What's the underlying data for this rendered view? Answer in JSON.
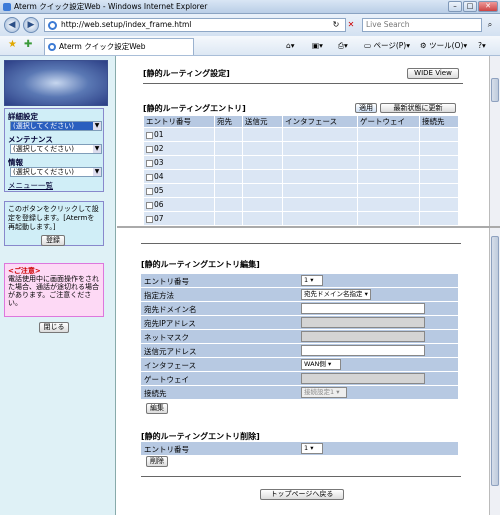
{
  "window": {
    "title": "Aterm クイック設定Web - Windows Internet Explorer"
  },
  "address": {
    "url": "http://web.setup/index_frame.html",
    "search_placeholder": "Live Search"
  },
  "tab": {
    "label": "Aterm クイック設定Web"
  },
  "toolbar": {
    "page": "ページ(P)",
    "tools": "ツール(O)",
    "help": "?"
  },
  "left": {
    "menu": {
      "detail_label": "詳細設定",
      "detail_value": "(選択してください)",
      "maint_label": "メンテナンス",
      "maint_value": "(選択してください)",
      "info_label": "情報",
      "info_value": "(選択してください)",
      "list_link": "メニュー一覧"
    },
    "register_text": "このボタンをクリックして設定を登録します。[Atermを再起動します。]",
    "register_button": "登録",
    "caution_title": "<ご注意>",
    "caution_text": "電話使用中に画面操作をされた場合、通話が途切れる場合があります。ご注意ください。",
    "close_button": "閉じる"
  },
  "main": {
    "page_title": "[静的ルーティング設定]",
    "wide_button": "WIDE View",
    "entry_title": "[静的ルーティングエントリ]",
    "apply_button": "適用",
    "refresh_button": "最新状態に更新",
    "entry_headers": [
      "エントリ番号",
      "宛先",
      "送信元",
      "インタフェース",
      "ゲートウェイ",
      "接続先"
    ],
    "entries": [
      "01",
      "02",
      "03",
      "04",
      "05",
      "06",
      "07"
    ],
    "edit_title": "[静的ルーティングエントリ編集]",
    "edit_fields": {
      "entry_no": "エントリ番号",
      "entry_no_value": "1",
      "method": "指定方法",
      "method_value": "宛先ドメイン名指定",
      "domain": "宛先ドメイン名",
      "ip": "宛先IPアドレス",
      "netmask": "ネットマスク",
      "src": "送信元アドレス",
      "iface": "インタフェース",
      "iface_value": "WAN側",
      "gateway": "ゲートウェイ",
      "dest": "接続先",
      "dest_value": "接続設定1"
    },
    "edit_button": "編集",
    "delete_title": "[静的ルーティングエントリ削除]",
    "delete_entry_label": "エントリ番号",
    "delete_entry_value": "1",
    "delete_button": "削除",
    "top_button": "トップページへ戻る"
  }
}
